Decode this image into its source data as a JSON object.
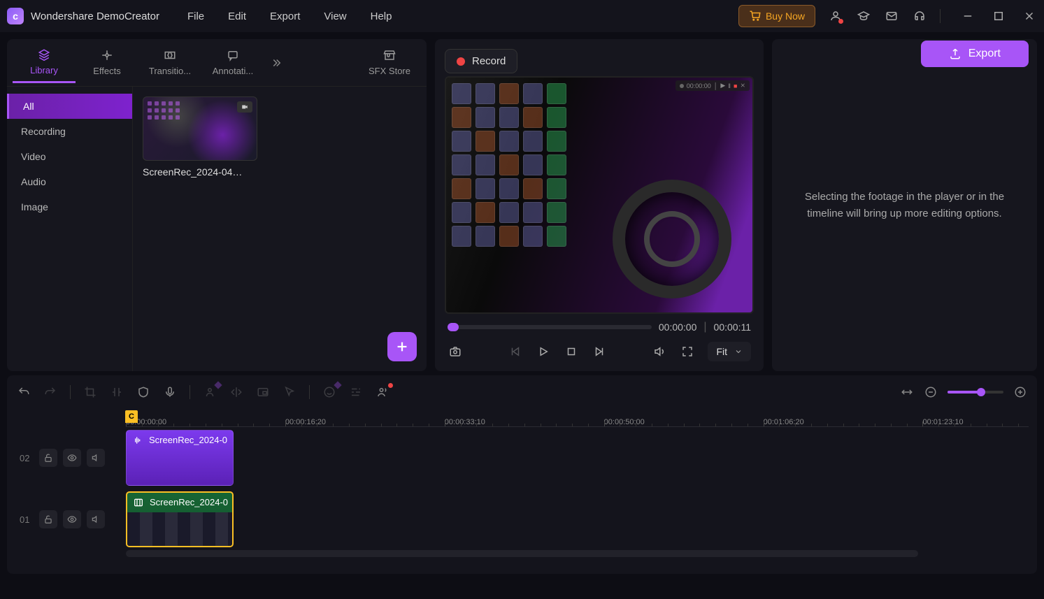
{
  "app": {
    "title": "Wondershare DemoCreator"
  },
  "menu": [
    "File",
    "Edit",
    "Export",
    "View",
    "Help"
  ],
  "titlebar": {
    "buy_now": "Buy Now"
  },
  "lib_tabs": [
    {
      "id": "library",
      "label": "Library",
      "icon": "layers"
    },
    {
      "id": "effects",
      "label": "Effects",
      "icon": "sparkle"
    },
    {
      "id": "transitions",
      "label": "Transitio...",
      "icon": "transition"
    },
    {
      "id": "annotations",
      "label": "Annotati...",
      "icon": "annotation"
    }
  ],
  "lib_tabs_overflow": true,
  "lib_tabs_right": {
    "id": "sfxstore",
    "label": "SFX Store",
    "icon": "store"
  },
  "lib_categories": [
    {
      "id": "all",
      "label": "All",
      "active": true
    },
    {
      "id": "recording",
      "label": "Recording"
    },
    {
      "id": "video",
      "label": "Video"
    },
    {
      "id": "audio",
      "label": "Audio"
    },
    {
      "id": "image",
      "label": "Image"
    }
  ],
  "clips": [
    {
      "name": "ScreenRec_2024-04…"
    }
  ],
  "preview": {
    "record_label": "Record",
    "current_time": "00:00:00",
    "duration": "00:00:11",
    "fit_label": "Fit",
    "rec_toolbar_time": "00:00:00"
  },
  "export_label": "Export",
  "inspector": {
    "message": "Selecting the footage in the player or in the timeline will bring up more editing options."
  },
  "timeline": {
    "ruler": [
      "00:00:00:00",
      "00:00:16:20",
      "00:00:33:10",
      "00:00:50:00",
      "00:01:06:20",
      "00:01:23:10"
    ],
    "tracks": [
      {
        "num": "02",
        "clip_label": "ScreenRec_2024-0",
        "type": "audio"
      },
      {
        "num": "01",
        "clip_label": "ScreenRec_2024-0",
        "type": "video"
      }
    ],
    "zoom_percent": 60
  }
}
